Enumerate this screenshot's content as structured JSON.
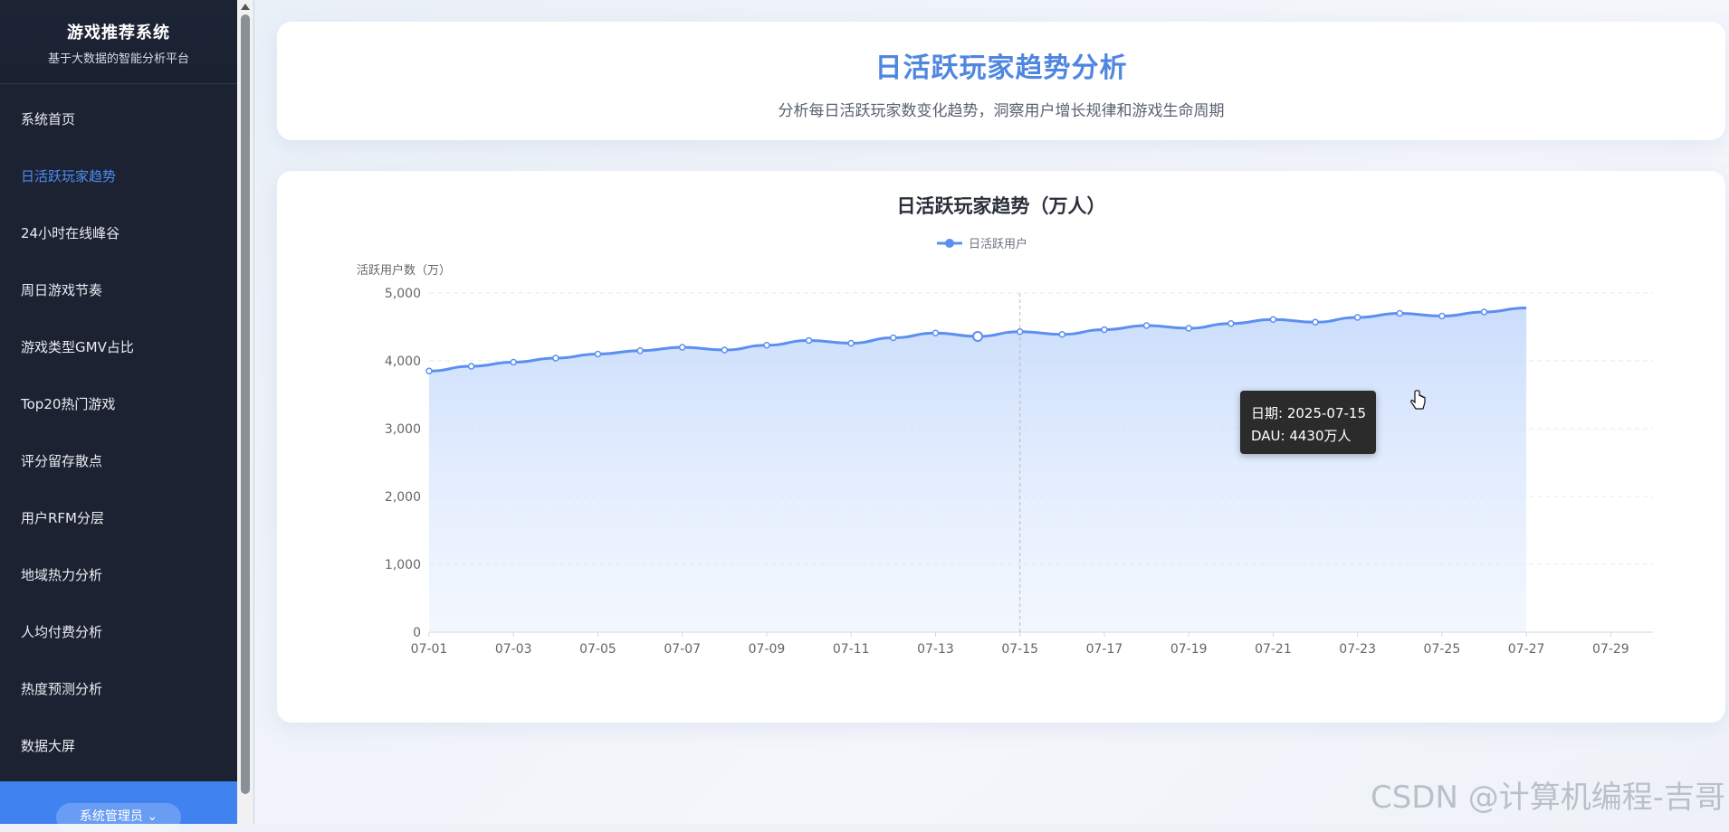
{
  "sidebar": {
    "title": "游戏推荐系统",
    "subtitle": "基于大数据的智能分析平台",
    "items": [
      {
        "label": "系统首页"
      },
      {
        "label": "日活跃玩家趋势"
      },
      {
        "label": "24小时在线峰谷"
      },
      {
        "label": "周日游戏节奏"
      },
      {
        "label": "游戏类型GMV占比"
      },
      {
        "label": "Top20热门游戏"
      },
      {
        "label": "评分留存散点"
      },
      {
        "label": "用户RFM分层"
      },
      {
        "label": "地域热力分析"
      },
      {
        "label": "人均付费分析"
      },
      {
        "label": "热度预测分析"
      },
      {
        "label": "数据大屏"
      }
    ],
    "active_index": 1,
    "admin_label": "系统管理员 ⌄"
  },
  "header": {
    "title": "日活跃玩家趋势分析",
    "subtitle": "分析每日活跃玩家数变化趋势，洞察用户增长规律和游戏生命周期"
  },
  "tooltip": {
    "date_line": "日期: 2025-07-15",
    "value_line": "DAU: 4430万人"
  },
  "watermark": "CSDN @计算机编程-吉哥",
  "chart_data": {
    "type": "area",
    "title": "日活跃玩家趋势（万人）",
    "ylabel": "活跃用户数（万）",
    "xlabel": "",
    "ylim": [
      0,
      5000
    ],
    "yticks": [
      "0",
      "1,000",
      "2,000",
      "3,000",
      "4,000",
      "5,000"
    ],
    "xticks": [
      "07-01",
      "07-03",
      "07-05",
      "07-07",
      "07-09",
      "07-11",
      "07-13",
      "07-15",
      "07-17",
      "07-19",
      "07-21",
      "07-23",
      "07-25",
      "07-27",
      "07-29"
    ],
    "x_range": [
      "07-01",
      "07-30"
    ],
    "grid": true,
    "legend": "top-center",
    "line_color": "#5b8ff0",
    "series": [
      {
        "name": "日活跃用户",
        "x": [
          "07-01",
          "07-02",
          "07-03",
          "07-04",
          "07-05",
          "07-06",
          "07-07",
          "07-08",
          "07-09",
          "07-10",
          "07-11",
          "07-12",
          "07-13",
          "07-14",
          "07-15",
          "07-16",
          "07-17",
          "07-18",
          "07-19",
          "07-20",
          "07-21",
          "07-22",
          "07-23",
          "07-24",
          "07-25",
          "07-26",
          "07-27"
        ],
        "values": [
          3850,
          3920,
          3980,
          4040,
          4100,
          4150,
          4200,
          4160,
          4230,
          4300,
          4260,
          4340,
          4410,
          4360,
          4430,
          4390,
          4460,
          4520,
          4480,
          4550,
          4610,
          4570,
          4640,
          4700,
          4660,
          4720,
          4780
        ]
      }
    ]
  }
}
